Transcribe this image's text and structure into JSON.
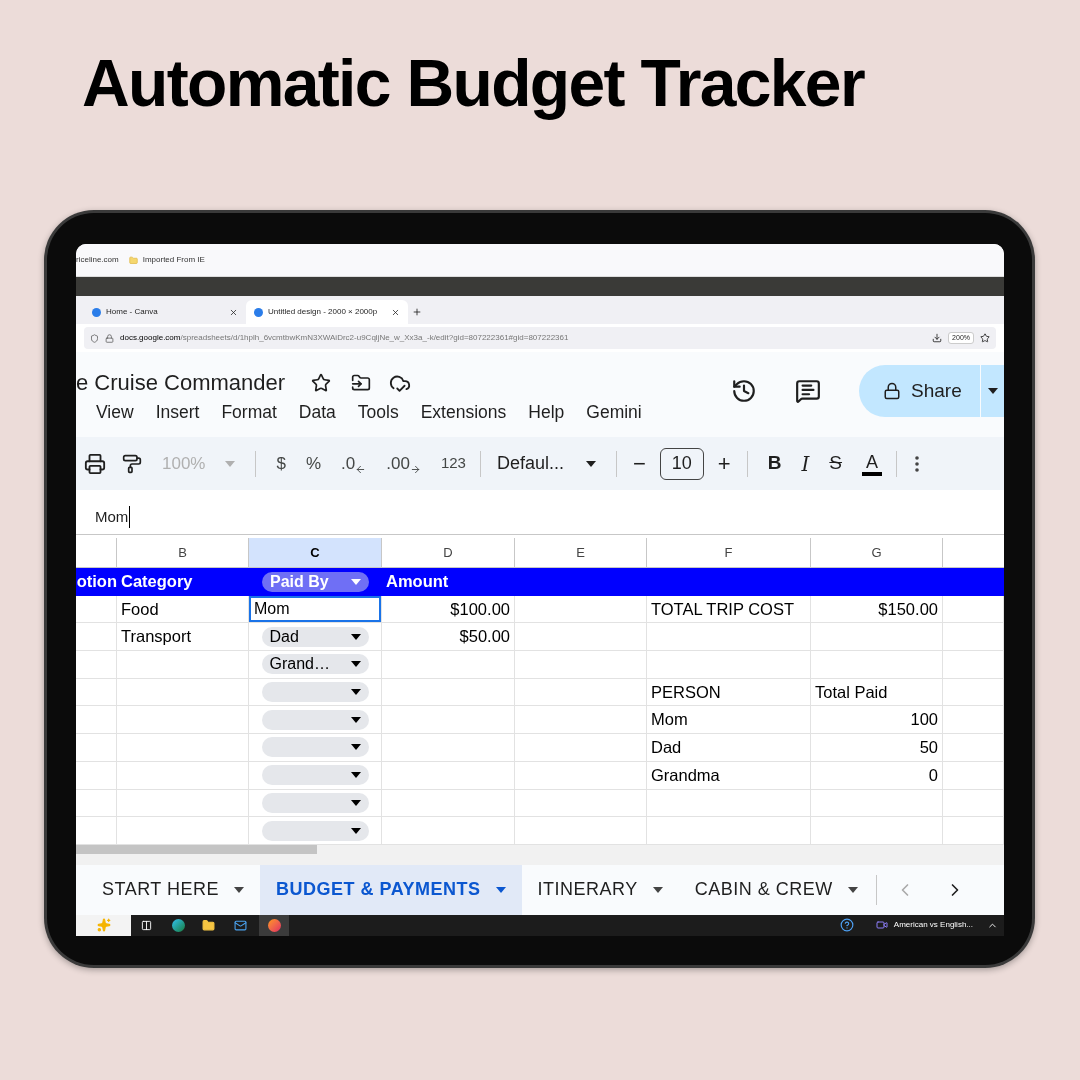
{
  "heading": "Automatic Budget Tracker",
  "browser": {
    "bookmarks": [
      "riceline.com",
      "Imported From IE"
    ],
    "tabs": [
      {
        "title": "Home - Canva",
        "selected": false
      },
      {
        "title": "Untitled design - 2000 × 2000p",
        "selected": true
      }
    ],
    "url": {
      "host": "docs.google.com",
      "path": "/spreadsheets/d/1hplh_6vcmtbwKmN3XWAiDrc2-u9CqljNe_w_Xx3a_-k/edit?gid=807222361#gid=807222361"
    },
    "zoom": "200%"
  },
  "sheets": {
    "title": "e Cruise Commander",
    "share": "Share",
    "menu": [
      "View",
      "Insert",
      "Format",
      "Data",
      "Tools",
      "Extensions",
      "Help",
      "Gemini"
    ],
    "toolbar": {
      "zoom": "100%",
      "currency": "$",
      "percent": "%",
      "decrease_decimals": ".0",
      "increase_decimals": ".00",
      "number_format": "123",
      "font": "Defaul...",
      "minus": "−",
      "font_size": "10",
      "plus": "+",
      "bold": "B",
      "italic": "I",
      "strikethrough": "S",
      "text_color": "A"
    },
    "formula": "Mom",
    "columns": [
      {
        "label": "B",
        "selected": false
      },
      {
        "label": "C",
        "selected": true
      },
      {
        "label": "D",
        "selected": false
      },
      {
        "label": "E",
        "selected": false
      },
      {
        "label": "F",
        "selected": false
      },
      {
        "label": "G",
        "selected": false
      }
    ],
    "rows": [
      {
        "kind": "header",
        "column_a": "otion",
        "category": "Category",
        "paid_by": {
          "kind": "chip",
          "value": "Paid By"
        },
        "amount": "Amount"
      },
      {
        "kind": "data",
        "category": "Food",
        "paid_by": {
          "kind": "editing",
          "value": "Mom"
        },
        "amount": "$100.00",
        "column_f": "TOTAL TRIP COST",
        "column_g": "$150.00"
      },
      {
        "kind": "data",
        "category": "Transport",
        "paid_by": {
          "kind": "chip",
          "value": "Dad"
        },
        "amount": "$50.00"
      },
      {
        "kind": "data",
        "paid_by": {
          "kind": "chip",
          "value": "Grand…"
        }
      },
      {
        "kind": "labels",
        "paid_by": {
          "kind": "chip"
        },
        "column_f": "PERSON",
        "column_g": "Total Paid"
      },
      {
        "kind": "data",
        "paid_by": {
          "kind": "chip"
        },
        "column_f": "Mom",
        "column_g": "100"
      },
      {
        "kind": "data",
        "paid_by": {
          "kind": "chip"
        },
        "column_f": "Dad",
        "column_g": "50"
      },
      {
        "kind": "data",
        "paid_by": {
          "kind": "chip"
        },
        "column_f": "Grandma",
        "column_g": "0"
      },
      {
        "kind": "data",
        "paid_by": {
          "kind": "chip"
        }
      },
      {
        "kind": "data",
        "paid_by": {
          "kind": "chip"
        }
      }
    ],
    "sheet_tabs": [
      {
        "label": "START HERE",
        "selected": false
      },
      {
        "label": "BUDGET & PAYMENTS",
        "selected": true
      },
      {
        "label": "ITINERARY",
        "selected": false
      },
      {
        "label": "CABIN & CREW",
        "selected": false
      }
    ]
  },
  "taskbar": {
    "media": "American vs English..."
  }
}
